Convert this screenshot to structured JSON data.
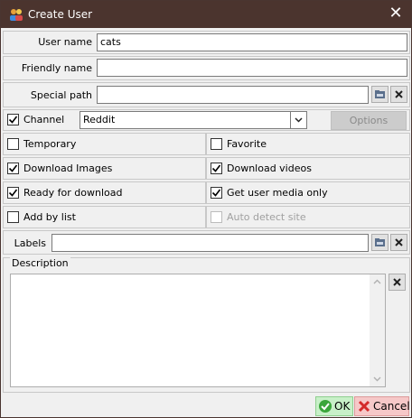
{
  "window": {
    "title": "Create User",
    "close_icon": "close-icon",
    "app_icon": "users-icon"
  },
  "fields": {
    "user_name": {
      "label": "User name",
      "value": "cats"
    },
    "friendly_name": {
      "label": "Friendly name",
      "value": ""
    },
    "special_path": {
      "label": "Special path",
      "value": ""
    }
  },
  "channel": {
    "label": "Channel",
    "checked": true,
    "selected": "Reddit",
    "options_label": "Options"
  },
  "checkboxes": [
    {
      "label": "Temporary",
      "checked": false
    },
    {
      "label": "Favorite",
      "checked": false
    },
    {
      "label": "Download Images",
      "checked": true
    },
    {
      "label": "Download videos",
      "checked": true
    },
    {
      "label": "Ready for download",
      "checked": true
    },
    {
      "label": "Get user media only",
      "checked": true
    },
    {
      "label": "Add by list",
      "checked": false
    },
    {
      "label": "Auto detect site",
      "checked": false,
      "disabled": true
    }
  ],
  "labels_field": {
    "label": "Labels",
    "value": ""
  },
  "description": {
    "legend": "Description",
    "value": ""
  },
  "footer": {
    "ok_label": "OK",
    "cancel_label": "Cancel"
  },
  "colors": {
    "titlebar": "#4b342e",
    "ok_bg": "#c8f0c8",
    "cancel_bg": "#f6c8c8"
  }
}
